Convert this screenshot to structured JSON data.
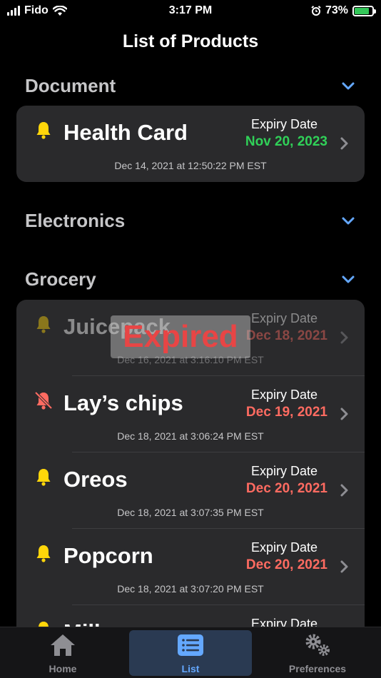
{
  "status_bar": {
    "carrier": "Fido",
    "time": "3:17 PM",
    "battery": "73%"
  },
  "title": "List of Products",
  "sections": [
    {
      "name": "Document"
    },
    {
      "name": "Electronics"
    },
    {
      "name": "Grocery"
    }
  ],
  "expiry_label": "Expiry Date",
  "document_items": [
    {
      "name": "Health Card",
      "expiry": "Nov 20, 2023",
      "created": "Dec 14, 2021 at 12:50:22 PM EST"
    }
  ],
  "grocery_items": [
    {
      "name": "Juicepack",
      "expiry": "Dec 18, 2021",
      "created": "Dec 16, 2021 at 3:16:10 PM EST",
      "badge": "Expired"
    },
    {
      "name": "Lay’s chips",
      "expiry": "Dec 19, 2021",
      "created": "Dec 18, 2021 at 3:06:24 PM EST"
    },
    {
      "name": "Oreos",
      "expiry": "Dec 20, 2021",
      "created": "Dec 18, 2021 at 3:07:35 PM EST"
    },
    {
      "name": "Popcorn",
      "expiry": "Dec 20, 2021",
      "created": "Dec 18, 2021 at 3:07:20 PM EST"
    },
    {
      "name": "Milk",
      "expiry": "",
      "created": ""
    }
  ],
  "tabs": [
    {
      "label": "Home",
      "icon": "house-icon"
    },
    {
      "label": "List",
      "icon": "list-icon",
      "active": true
    },
    {
      "label": "Preferences",
      "icon": "gears-icon"
    }
  ],
  "colors": {
    "expired_red": "#ff6b61",
    "valid_green": "#30d158",
    "bell_yellow": "#ffd60a",
    "accent_blue": "#64a8ff"
  }
}
